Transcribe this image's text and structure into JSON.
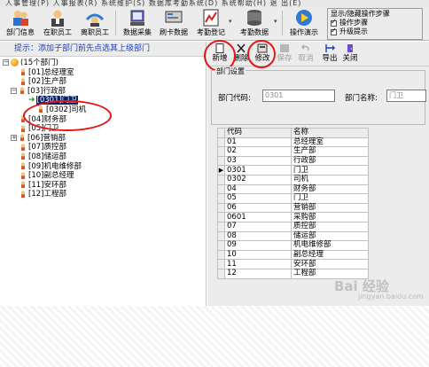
{
  "menubar": {
    "text": "人事管理(P)  人事报表(R)  系统维护(S)  数据库考勤系统(D)  系统帮助(H)  退    出(E)"
  },
  "toolbar": {
    "buttons": [
      {
        "label": "部门信息"
      },
      {
        "label": "在职员工"
      },
      {
        "label": "离职员工"
      },
      {
        "label": "数据采集"
      },
      {
        "label": "刷卡数据"
      },
      {
        "label": "考勤登记"
      },
      {
        "label": "考勤数据"
      },
      {
        "label": "操作演示"
      }
    ],
    "showhide": {
      "title": "显示/隐藏操作步骤",
      "opt1": "操作步骤",
      "opt2": "升级提示"
    }
  },
  "left": {
    "hint": "提示：添加子部门前先点选其上级部门",
    "root": "(15个部门)",
    "nodes": [
      {
        "label": "[01]总经理室"
      },
      {
        "label": "[02]生产部"
      },
      {
        "label": "[03]行政部"
      },
      {
        "label": "[0301]门卫"
      },
      {
        "label": "[0302]司机"
      },
      {
        "label": "[04]财务部"
      },
      {
        "label": "[05]门卫"
      },
      {
        "label": "[06]营销部"
      },
      {
        "label": "[07]质控部"
      },
      {
        "label": "[08]储运部"
      },
      {
        "label": "[09]机电维修部"
      },
      {
        "label": "[10]副总经理"
      },
      {
        "label": "[11]安环部"
      },
      {
        "label": "[12]工程部"
      }
    ]
  },
  "right": {
    "buttons": {
      "add": "新增",
      "delete": "删除",
      "edit": "修改",
      "save": "保存",
      "cancel": "取消",
      "export": "导出",
      "close": "关闭"
    },
    "group_title": "部门设置",
    "code_label": "部门代码:",
    "code_value": "0301",
    "name_label": "部门名称:",
    "name_value": "门卫",
    "grid": {
      "headers": [
        "代码",
        "名称"
      ],
      "rows": [
        [
          "01",
          "总经理室"
        ],
        [
          "02",
          "生产部"
        ],
        [
          "03",
          "行政部"
        ],
        [
          "0301",
          "门卫"
        ],
        [
          "0302",
          "司机"
        ],
        [
          "04",
          "财务部"
        ],
        [
          "05",
          "门卫"
        ],
        [
          "06",
          "营销部"
        ],
        [
          "0601",
          "采购部"
        ],
        [
          "07",
          "质控部"
        ],
        [
          "08",
          "储运部"
        ],
        [
          "09",
          "机电维修部"
        ],
        [
          "10",
          "副总经理"
        ],
        [
          "11",
          "安环部"
        ],
        [
          "12",
          "工程部"
        ]
      ],
      "current_row": 3
    }
  },
  "watermark": {
    "main": "Bai 经验",
    "sub": "jingyan.baidu.com"
  }
}
